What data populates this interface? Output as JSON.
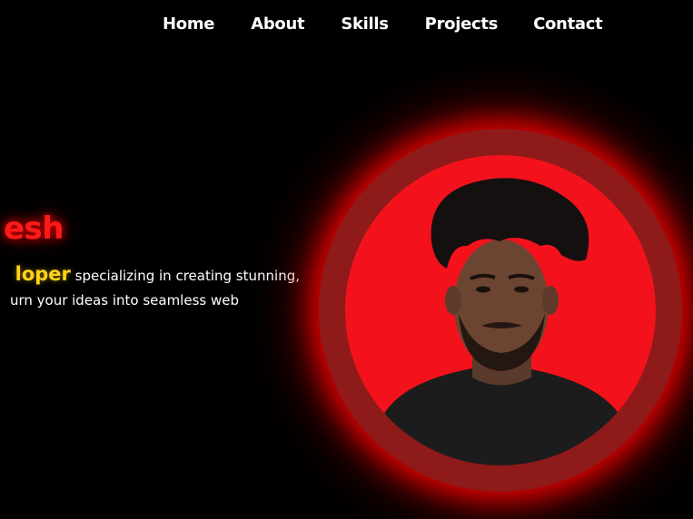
{
  "nav": {
    "items": [
      {
        "label": "Home"
      },
      {
        "label": "About"
      },
      {
        "label": "Skills"
      },
      {
        "label": "Projects"
      },
      {
        "label": "Contact"
      }
    ]
  },
  "hero": {
    "name_fragment": "esh",
    "role_fragment": "loper",
    "line1_rest": " specializing in creating stunning,",
    "line2": "urn your ideas into seamless web"
  },
  "colors": {
    "background": "#000000",
    "accent_red": "#ff1a1a",
    "accent_yellow": "#ffd21a",
    "ring": "#8f1a1a",
    "avatar_bg": "#f3121c"
  },
  "avatar": {
    "icon": "person-portrait"
  }
}
